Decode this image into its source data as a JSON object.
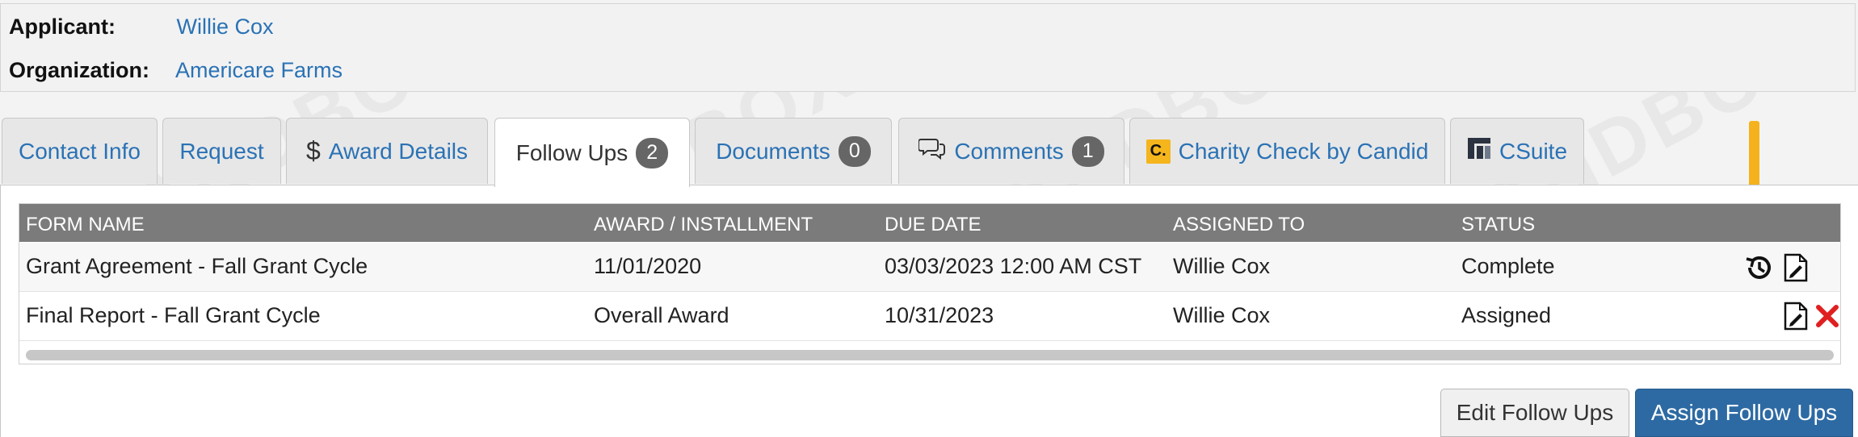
{
  "applicant": {
    "applicant_label": "Applicant:",
    "applicant_value": "Willie Cox",
    "organization_label": "Organization:",
    "organization_value": "Americare Farms"
  },
  "tabs": [
    {
      "label": "Contact Info"
    },
    {
      "label": "Request"
    },
    {
      "label": "Award Details",
      "icon": "dollar-icon"
    },
    {
      "label": "Follow Ups",
      "badge": "2",
      "active": true
    },
    {
      "label": "Documents",
      "badge": "0"
    },
    {
      "label": "Comments",
      "badge": "1",
      "icon": "comments-icon"
    },
    {
      "label": "Charity Check by Candid",
      "icon": "candid-logo-icon",
      "logo_text": "C."
    },
    {
      "label": "CSuite",
      "icon": "csuite-logo-icon"
    }
  ],
  "grid": {
    "columns": [
      "FORM NAME",
      "AWARD / INSTALLMENT",
      "DUE DATE",
      "ASSIGNED TO",
      "STATUS"
    ],
    "rows": [
      {
        "form_name": "Grant Agreement - Fall Grant Cycle",
        "award": "11/01/2020",
        "due_date": "03/03/2023 12:00 AM CST",
        "assigned_to": "Willie Cox",
        "status": "Complete",
        "actions": [
          "history-icon",
          "edit-document-icon"
        ]
      },
      {
        "form_name": "Final Report - Fall Grant Cycle",
        "award": "Overall Award",
        "due_date": "10/31/2023",
        "assigned_to": "Willie Cox",
        "status": "Assigned",
        "actions": [
          "edit-document-icon",
          "delete-x-icon"
        ]
      }
    ]
  },
  "buttons": {
    "edit": "Edit Follow Ups",
    "assign": "Assign Follow Ups"
  },
  "colors": {
    "link": "#2a72b5",
    "header": "#7b7b7b",
    "primary_button": "#2d6aa3",
    "annotation_arrow": "#f5b21c",
    "delete": "#e02020"
  }
}
